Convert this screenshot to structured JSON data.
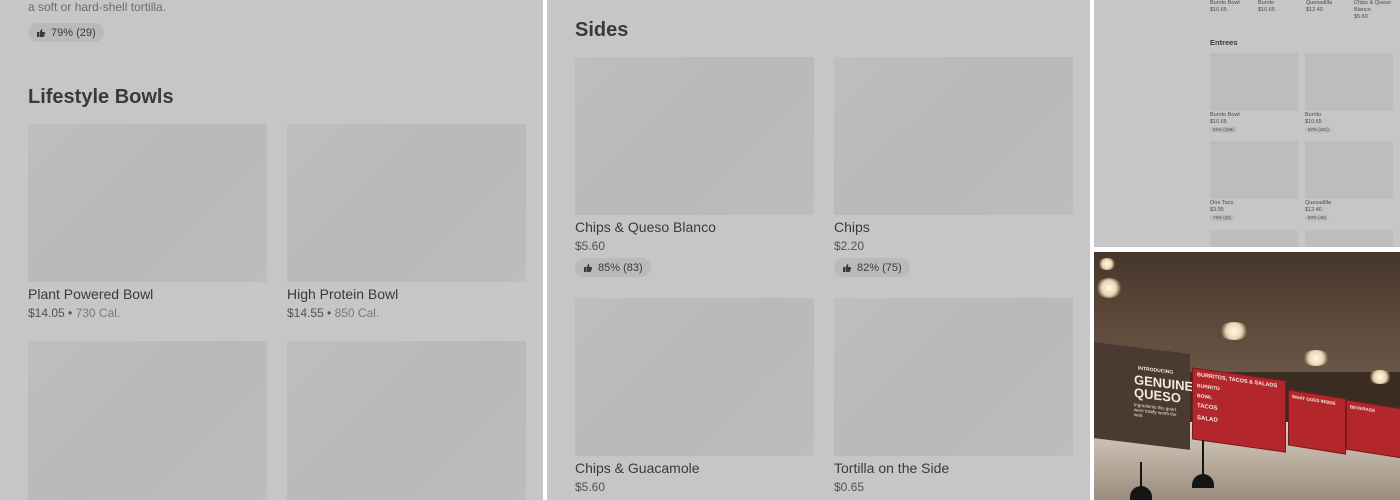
{
  "left_panel": {
    "desc_fragment": "a soft or hard-shell tortilla.",
    "top_rating": "79% (29)",
    "section_title": "Lifestyle Bowls",
    "items": [
      {
        "name": "Plant Powered Bowl",
        "price": "$14.05",
        "cal": "730 Cal."
      },
      {
        "name": "High Protein Bowl",
        "price": "$14.55",
        "cal": "850 Cal."
      }
    ]
  },
  "middle_panel": {
    "section_title": "Sides",
    "items": [
      {
        "name": "Chips & Queso Blanco",
        "price": "$5.60",
        "rating": "85% (83)"
      },
      {
        "name": "Chips",
        "price": "$2.20",
        "rating": "82% (75)"
      },
      {
        "name": "Chips & Guacamole",
        "price": "$5.60"
      },
      {
        "name": "Tortilla on the Side",
        "price": "$0.65"
      }
    ]
  },
  "mini_panel": {
    "top_row": [
      {
        "name": "Burrito Bowl",
        "price": "$10.65"
      },
      {
        "name": "Burrito",
        "price": "$10.65"
      },
      {
        "name": "Quesadilla",
        "price": "$12.40"
      },
      {
        "name": "Chips & Queso Blanco",
        "price": "$5.60"
      }
    ],
    "section_title": "Entrees",
    "items": [
      {
        "name": "Burrito Bowl",
        "price": "$10.65",
        "rating": "82% (169)"
      },
      {
        "name": "Burrito",
        "price": "$10.65",
        "rating": "82% (161)"
      },
      {
        "name": "One Taco",
        "price": "$3.95",
        "rating": "73% (22)"
      },
      {
        "name": "Quesadilla",
        "price": "$12.40",
        "rating": "83% (45)"
      }
    ]
  },
  "photo": {
    "sign_small": "INTRODUCING",
    "sign_main": "GENUINE QUESO",
    "sign_sub": "Ingredients this good were totally worth the wait.",
    "board1_header": "BURRITOS, TACOS & SALADS",
    "board1_items": [
      "BURRITO",
      "BOWL",
      "TACOS",
      "SALAD"
    ],
    "board2_header": "WHAT GOES INSIDE",
    "board3_header": "BEVERAGE"
  },
  "colors": {
    "panel_bg": "#c6c6c6",
    "placeholder": "#bdbdbd",
    "chipotle_red": "#b3262c"
  }
}
